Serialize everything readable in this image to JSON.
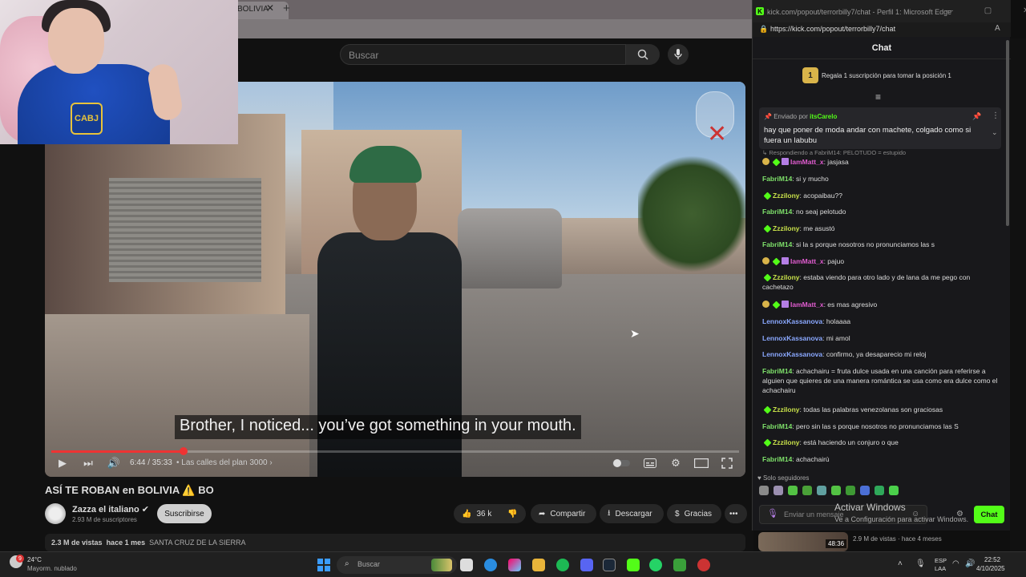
{
  "browser": {
    "tab_title": "BOLIVIA",
    "tab_close": "✕",
    "new_tab": "+"
  },
  "youtube": {
    "search_placeholder": "Buscar",
    "subtitle": "Brother, I noticed... you’ve got something in your mouth.",
    "time": "6:44 / 35:33",
    "chapter": "• Las calles del plan 3000 ›",
    "title": "ASÍ TE ROBAN en BOLIVIA ⚠️ BO",
    "channel_name": "Zazza el italiano ✔",
    "channel_subs": "2.93 M de suscriptores",
    "subscribe": "Suscribirse",
    "likes": "36 k",
    "share": "Compartir",
    "download": "Descargar",
    "thanks": "Gracias",
    "more": "•••",
    "views": "2.3 M de vistas",
    "age": "hace 1 mes",
    "location": "SANTA CRUZ DE LA SIERRA",
    "side_duration": "48:36",
    "side_meta": "2.9 M de vistas  ·  hace 4 meses"
  },
  "webcam": {
    "badge": "CABJ"
  },
  "chat_window": {
    "window_title": "kick.com/popout/terrorbilly7/chat - Perfil 1: Microsoft Edge",
    "window_controls": "— ▢ ✕",
    "url": "https://kick.com/popout/terrorbilly7/chat",
    "header": "Chat",
    "gift_rank": "1",
    "gift_text": "Regala 1 suscripción para tomar la posición 1",
    "pinned_by_label": "Enviado por ",
    "pinned_user": "itsCarelo",
    "pinned_message": "hay que poner de moda andar con machete, colgado como si fuera un labubu",
    "reply_context": "↳ Respondiendo a FabriM14: PELOTUDO = estupido",
    "followers_only": "♥ Solo seguidores",
    "input_placeholder": "Enviar un mensaje",
    "send": "Chat",
    "watermark_title": "Activar Windows",
    "watermark_sub": "Ve a Configuración para activar Windows."
  },
  "chat_messages": [
    {
      "user": "IamMatt_x",
      "text": ": jasjasa",
      "color": "#e05ccf",
      "badges": [
        "gold",
        "green",
        "purple"
      ]
    },
    {
      "user": "FabriM14",
      "text": ": si y mucho",
      "color": "#7ee06a",
      "badges": []
    },
    {
      "user": "Zzzilony",
      "text": ": acopaibau??",
      "color": "#c8e04a",
      "badges": [
        "green"
      ]
    },
    {
      "user": "FabriM14",
      "text": ": no seaj pelotudo",
      "color": "#7ee06a",
      "badges": []
    },
    {
      "user": "Zzzilony",
      "text": ": me asustó",
      "color": "#c8e04a",
      "badges": [
        "green"
      ]
    },
    {
      "user": "FabriM14",
      "text": ": si la s porque nosotros no pronunciamos las s",
      "color": "#7ee06a",
      "badges": []
    },
    {
      "user": "IamMatt_x",
      "text": ": pajuo",
      "color": "#e05ccf",
      "badges": [
        "gold",
        "green",
        "purple"
      ]
    },
    {
      "user": "Zzzilony",
      "text": ": estaba viendo para otro lado y de lana da me pego con cachetazo",
      "color": "#c8e04a",
      "badges": [
        "green"
      ]
    },
    {
      "user": "IamMatt_x",
      "text": ": es mas agresivo",
      "color": "#e05ccf",
      "badges": [
        "gold",
        "green",
        "purple"
      ]
    },
    {
      "user": "LennoxKassanova",
      "text": ": holaaaa",
      "color": "#8aa8ff",
      "badges": []
    },
    {
      "user": "LennoxKassanova",
      "text": ": mi amol",
      "color": "#8aa8ff",
      "badges": []
    },
    {
      "user": "LennoxKassanova",
      "text": ": confirmo, ya desaparecio mi reloj",
      "color": "#8aa8ff",
      "badges": []
    },
    {
      "user": "FabriM14",
      "text": ": achachairu = fruta dulce usada en una canción para referirse a alguien que quieres de una manera romántica se usa como era dulce como el achachairu",
      "color": "#7ee06a",
      "badges": []
    },
    {
      "user": "Zzzilony",
      "text": ": todas las palabras venezolanas son graciosas",
      "color": "#c8e04a",
      "badges": [
        "green"
      ]
    },
    {
      "user": "FabriM14",
      "text": ": pero sin las s porque nosotros no pronunciamos las S",
      "color": "#7ee06a",
      "badges": []
    },
    {
      "user": "Zzzilony",
      "text": ": está haciendo un conjuro o que",
      "color": "#c8e04a",
      "badges": [
        "green"
      ]
    },
    {
      "user": "FabriM14",
      "text": ": achachairù",
      "color": "#7ee06a",
      "badges": []
    }
  ],
  "taskbar": {
    "weather_badge": "9",
    "temp": "24°C",
    "weather": "Mayorm. nublado",
    "search": "Buscar",
    "lang1": "ESP",
    "lang2": "LAA",
    "time": "22:52",
    "date": "4/10/2025"
  },
  "colors": {
    "kick_green": "#53fc18",
    "yt_red": "#e33333"
  }
}
